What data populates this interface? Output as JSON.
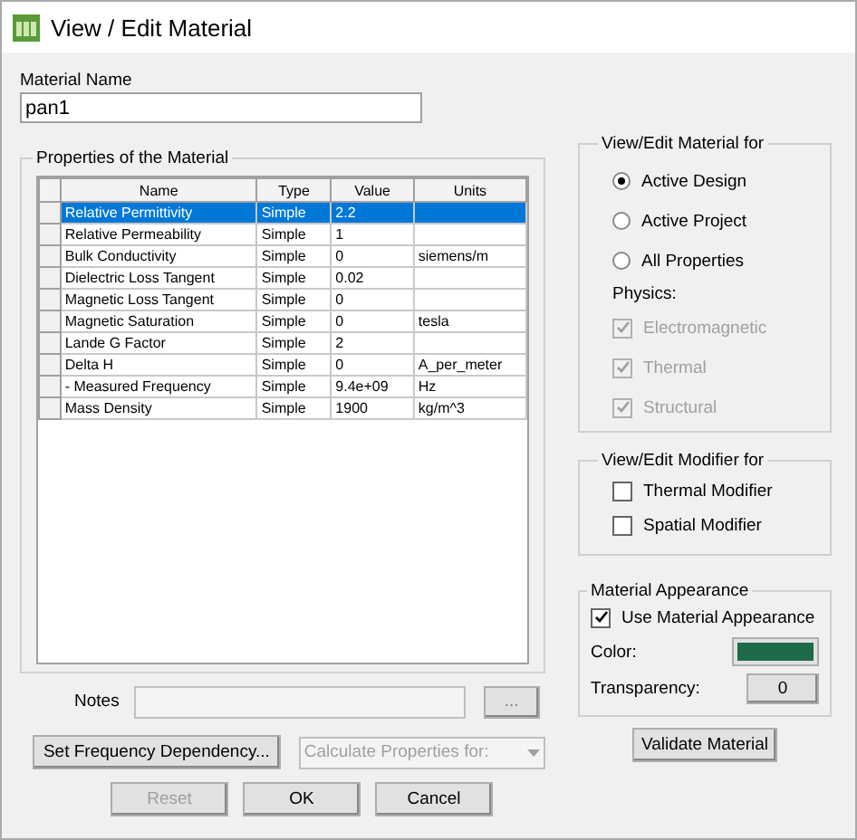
{
  "window": {
    "title": "View / Edit Material"
  },
  "material_name": {
    "label": "Material Name",
    "value": "pan1"
  },
  "properties": {
    "title": "Properties of the Material",
    "columns": [
      "Name",
      "Type",
      "Value",
      "Units"
    ],
    "rows": [
      {
        "name": "Relative Permittivity",
        "type": "Simple",
        "value": "2.2",
        "units": "",
        "selected": true
      },
      {
        "name": "Relative Permeability",
        "type": "Simple",
        "value": "1",
        "units": "",
        "selected": false
      },
      {
        "name": "Bulk Conductivity",
        "type": "Simple",
        "value": "0",
        "units": "siemens/m",
        "selected": false
      },
      {
        "name": "Dielectric Loss Tangent",
        "type": "Simple",
        "value": "0.02",
        "units": "",
        "selected": false
      },
      {
        "name": "Magnetic Loss Tangent",
        "type": "Simple",
        "value": "0",
        "units": "",
        "selected": false
      },
      {
        "name": "Magnetic Saturation",
        "type": "Simple",
        "value": "0",
        "units": "tesla",
        "selected": false
      },
      {
        "name": "Lande G Factor",
        "type": "Simple",
        "value": "2",
        "units": "",
        "selected": false
      },
      {
        "name": "Delta H",
        "type": "Simple",
        "value": "0",
        "units": "A_per_meter",
        "selected": false
      },
      {
        "name": "-  Measured Frequency",
        "type": "Simple",
        "value": "9.4e+09",
        "units": "Hz",
        "selected": false
      },
      {
        "name": "Mass Density",
        "type": "Simple",
        "value": "1900",
        "units": "kg/m^3",
        "selected": false
      }
    ]
  },
  "view_edit_for": {
    "title": "View/Edit Material for",
    "options": [
      {
        "label": "Active Design",
        "selected": true
      },
      {
        "label": "Active Project",
        "selected": false
      },
      {
        "label": "All Properties",
        "selected": false
      }
    ],
    "physics_label": "Physics:",
    "physics": [
      {
        "label": "Electromagnetic",
        "checked": true,
        "disabled": true
      },
      {
        "label": "Thermal",
        "checked": true,
        "disabled": true
      },
      {
        "label": "Structural",
        "checked": true,
        "disabled": true
      }
    ]
  },
  "modifier": {
    "title": "View/Edit Modifier for",
    "options": [
      {
        "label": "Thermal Modifier",
        "checked": false
      },
      {
        "label": "Spatial Modifier",
        "checked": false
      }
    ]
  },
  "appearance": {
    "title": "Material Appearance",
    "use": {
      "label": "Use Material Appearance",
      "checked": true
    },
    "color_label": "Color:",
    "color": "#1e6b4a",
    "transparency_label": "Transparency:",
    "transparency": "0"
  },
  "notes": {
    "label": "Notes",
    "browse": "..."
  },
  "frequency_button": "Set Frequency Dependency...",
  "calculate": {
    "placeholder": "Calculate Properties for:"
  },
  "buttons": [
    {
      "label": "Reset",
      "disabled": true
    },
    {
      "label": "OK",
      "disabled": false
    },
    {
      "label": "Cancel",
      "disabled": false
    }
  ],
  "validate_button": "Validate Material"
}
